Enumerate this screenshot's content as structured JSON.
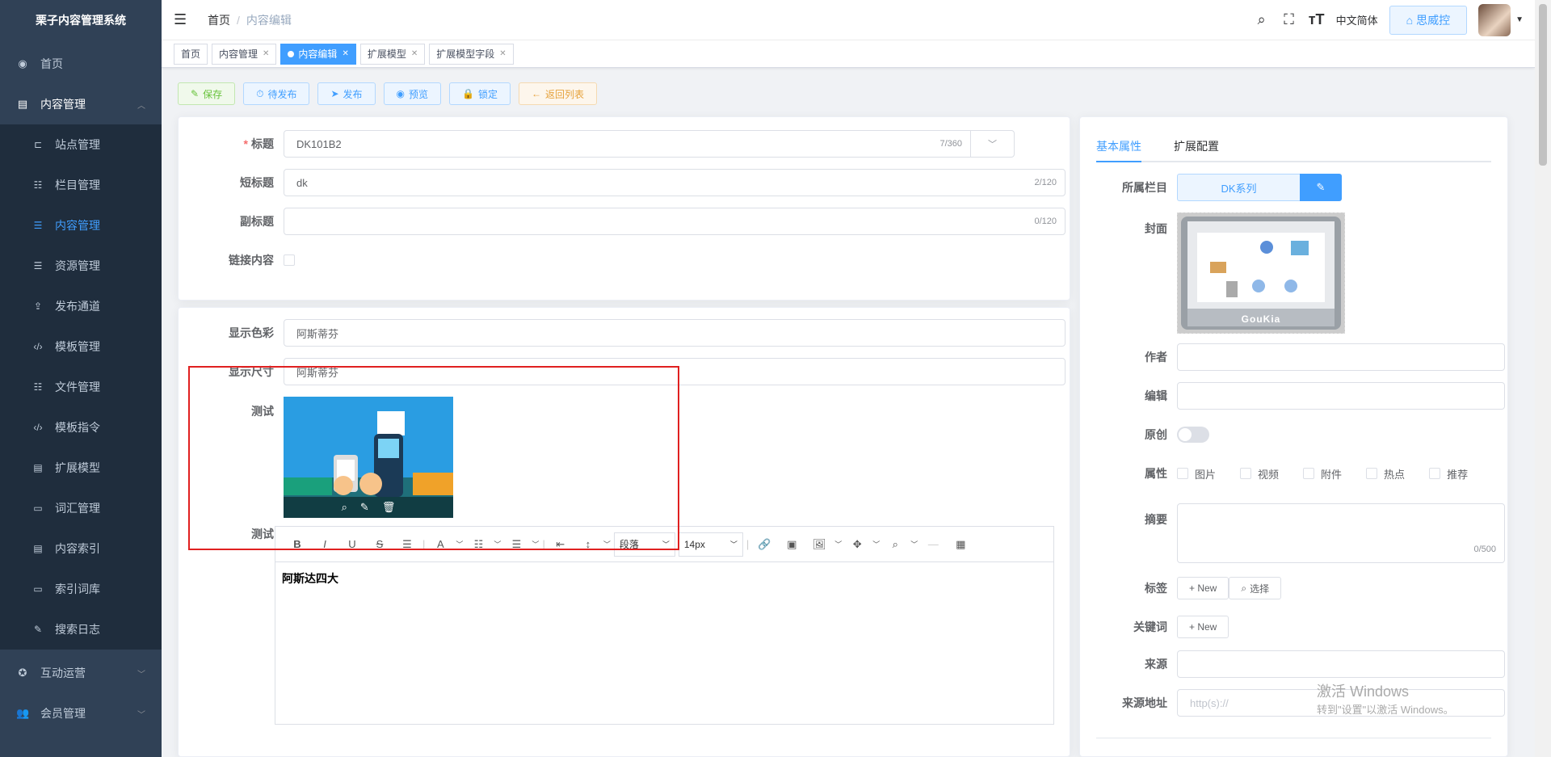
{
  "app": {
    "title": "栗子内容管理系统"
  },
  "sidebar": {
    "items": [
      {
        "label": "首页",
        "icon": "dashboard-icon"
      },
      {
        "label": "内容管理",
        "icon": "document-icon"
      },
      {
        "label": "互动运营",
        "icon": "interaction-icon"
      },
      {
        "label": "会员管理",
        "icon": "user-icon"
      }
    ],
    "subitems": [
      {
        "label": "站点管理",
        "icon": "site-icon"
      },
      {
        "label": "栏目管理",
        "icon": "tree-icon"
      },
      {
        "label": "内容管理",
        "icon": "list-icon"
      },
      {
        "label": "资源管理",
        "icon": "list-icon"
      },
      {
        "label": "发布通道",
        "icon": "publish-icon"
      },
      {
        "label": "模板管理",
        "icon": "code-icon"
      },
      {
        "label": "文件管理",
        "icon": "tree-icon"
      },
      {
        "label": "模板指令",
        "icon": "code-icon"
      },
      {
        "label": "扩展模型",
        "icon": "document-icon"
      },
      {
        "label": "词汇管理",
        "icon": "box-icon"
      },
      {
        "label": "内容索引",
        "icon": "document-icon"
      },
      {
        "label": "索引词库",
        "icon": "box-icon"
      },
      {
        "label": "搜索日志",
        "icon": "edit-icon"
      }
    ]
  },
  "header": {
    "breadcrumb": [
      "首页",
      "内容编辑"
    ],
    "lang": "中文简体",
    "user": "思威控"
  },
  "tags": [
    {
      "label": "首页",
      "closable": false,
      "active": false
    },
    {
      "label": "内容管理",
      "closable": true,
      "active": false
    },
    {
      "label": "内容编辑",
      "closable": true,
      "active": true
    },
    {
      "label": "扩展模型",
      "closable": true,
      "active": false
    },
    {
      "label": "扩展模型字段",
      "closable": true,
      "active": false
    }
  ],
  "toolbar": {
    "save": "保存",
    "pending": "待发布",
    "publish": "发布",
    "preview": "预览",
    "lock": "锁定",
    "back": "返回列表"
  },
  "form": {
    "title": {
      "label": "标题",
      "value": "DK101B2",
      "count": "7/360"
    },
    "short_title": {
      "label": "短标题",
      "value": "dk",
      "count": "2/120"
    },
    "subtitle": {
      "label": "副标题",
      "value": "",
      "count": "0/120"
    },
    "link_content": {
      "label": "链接内容"
    },
    "color": {
      "label": "显示色彩",
      "value": "阿斯蒂芬"
    },
    "size": {
      "label": "显示尺寸",
      "value": "阿斯蒂芬"
    },
    "test_image": {
      "label": "测试"
    },
    "test_editor": {
      "label": "测试",
      "content": "阿斯达四大",
      "paragraph": "段落",
      "font_size": "14px"
    }
  },
  "right": {
    "tabs": [
      "基本属性",
      "扩展配置"
    ],
    "catalog": {
      "label": "所属栏目",
      "value": "DK系列"
    },
    "cover": {
      "label": "封面",
      "brand": "GouKia"
    },
    "author": {
      "label": "作者"
    },
    "editor": {
      "label": "编辑"
    },
    "original": {
      "label": "原创"
    },
    "attributes": {
      "label": "属性",
      "options": [
        "图片",
        "视频",
        "附件",
        "热点",
        "推荐"
      ]
    },
    "summary": {
      "label": "摘要",
      "count": "0/500"
    },
    "tags": {
      "label": "标签",
      "new": "+ New",
      "select": "选择"
    },
    "keywords": {
      "label": "关键词",
      "new": "+ New"
    },
    "source": {
      "label": "来源"
    },
    "source_url": {
      "label": "来源地址",
      "placeholder": "http(s)://"
    }
  },
  "watermark": {
    "line1": "激活 Windows",
    "line2": "转到\"设置\"以激活 Windows。"
  },
  "colors": {
    "sidebar": "#304156",
    "primary": "#409eff",
    "success": "#67c23a",
    "warning": "#e6a23c",
    "highlight": "#e02020"
  }
}
